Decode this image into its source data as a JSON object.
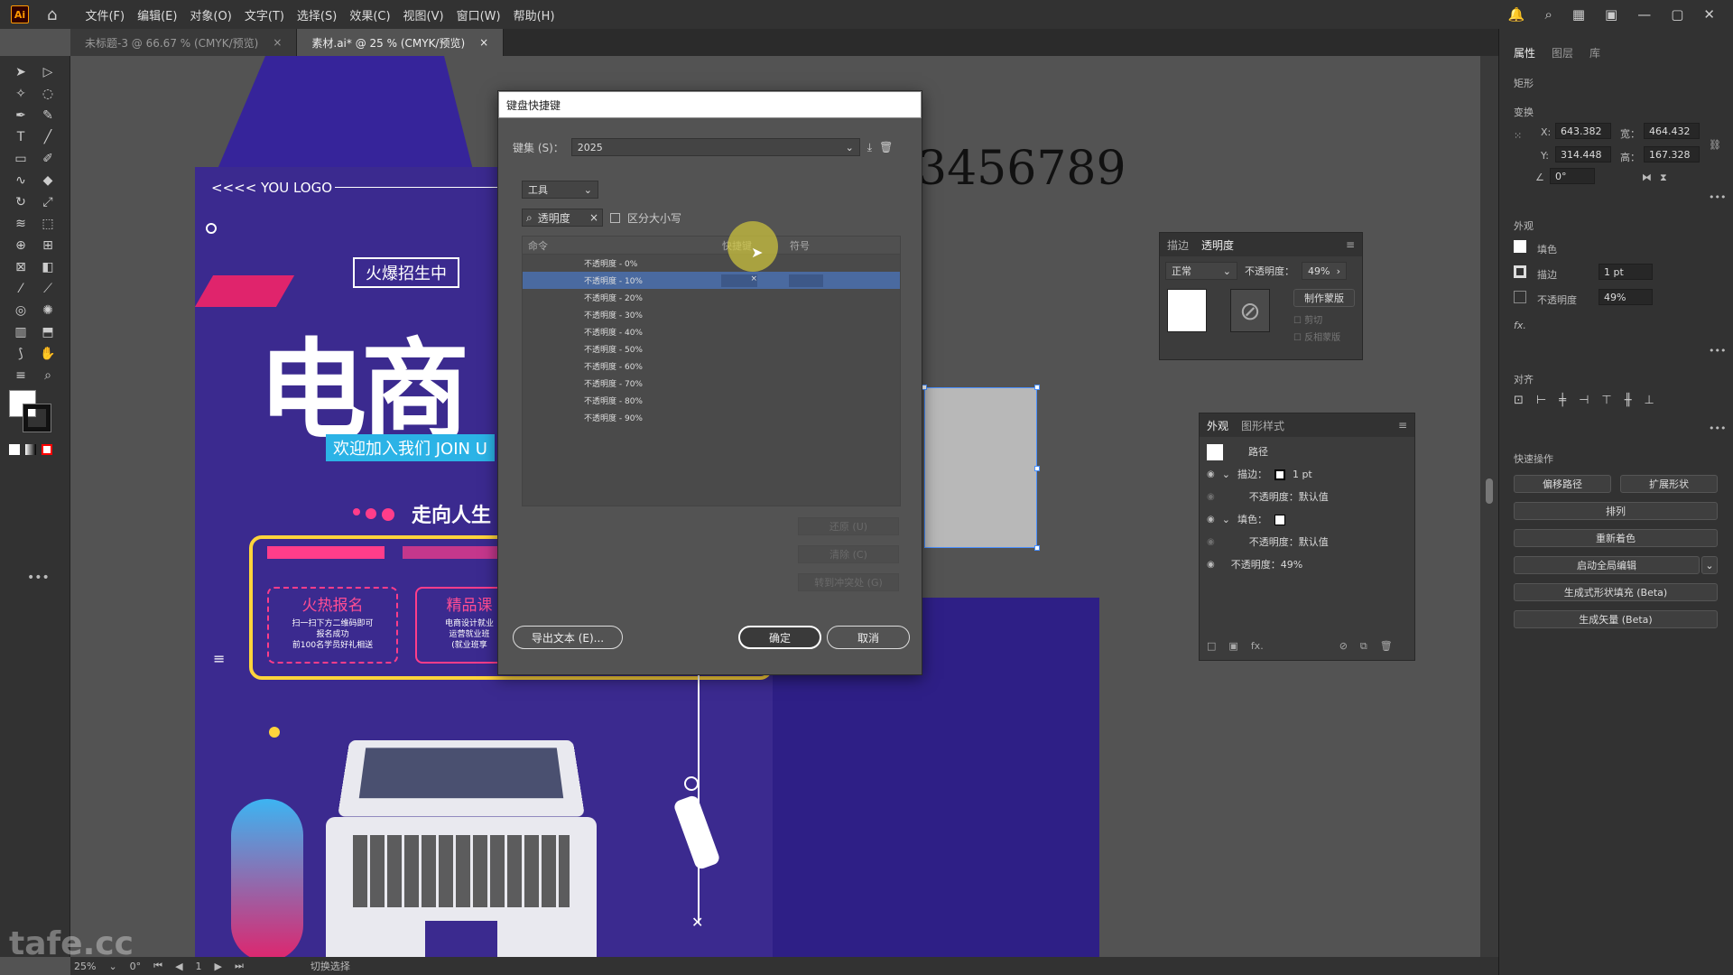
{
  "menubar": {
    "logo": "Ai",
    "items": [
      "文件(F)",
      "编辑(E)",
      "对象(O)",
      "文字(T)",
      "选择(S)",
      "效果(C)",
      "视图(V)",
      "窗口(W)",
      "帮助(H)"
    ]
  },
  "tabs": [
    {
      "label": "未标题-3 @ 66.67 % (CMYK/预览)",
      "active": false
    },
    {
      "label": "素材.ai* @ 25 % (CMYK/预览)",
      "active": true
    }
  ],
  "poster": {
    "logo": "<<<<  YOU LOGO",
    "hot": "火爆招生中",
    "big_title": "电商",
    "welcome": "欢迎加入我们 JOIN U",
    "goal": "走向人生",
    "reg_title": "火热报名",
    "reg_lines": [
      "扫一扫下方二维码即可",
      "报名成功",
      "前100名学员好礼相送"
    ],
    "course_title": "精品课",
    "course_lines": [
      "电商设计就业",
      "运营就业班",
      "(就业班享"
    ]
  },
  "canvas_number": "3456789",
  "dialog": {
    "title": "键盘快捷键",
    "keyset_label": "键集 (S)：",
    "keyset_value": "2025",
    "category": "工具",
    "search_value": "透明度",
    "case_label": "区分大小写",
    "columns": [
      "命令",
      "快捷键",
      "符号"
    ],
    "rows": [
      {
        "cmd": "不透明度 - 0%",
        "key": "",
        "sel": false
      },
      {
        "cmd": "不透明度 - 10%",
        "key": "×",
        "sel": true
      },
      {
        "cmd": "不透明度 - 20%",
        "key": "",
        "sel": false
      },
      {
        "cmd": "不透明度 - 30%",
        "key": "",
        "sel": false
      },
      {
        "cmd": "不透明度 - 40%",
        "key": "",
        "sel": false
      },
      {
        "cmd": "不透明度 - 50%",
        "key": "",
        "sel": false
      },
      {
        "cmd": "不透明度 - 60%",
        "key": "",
        "sel": false
      },
      {
        "cmd": "不透明度 - 70%",
        "key": "",
        "sel": false
      },
      {
        "cmd": "不透明度 - 80%",
        "key": "",
        "sel": false
      },
      {
        "cmd": "不透明度 - 90%",
        "key": "",
        "sel": false
      }
    ],
    "side_buttons": [
      "还原 (U)",
      "清除 (C)",
      "转到冲突处 (G)"
    ],
    "export": "导出文本 (E)...",
    "ok": "确定",
    "cancel": "取消"
  },
  "transparency_panel": {
    "tabs": [
      "描边",
      "透明度"
    ],
    "mode": "正常",
    "opacity_label": "不透明度：",
    "opacity_value": "49%",
    "make_mask": "制作蒙版",
    "clip": "剪切",
    "invert": "反相蒙版"
  },
  "appearance_panel": {
    "tabs": [
      "外观",
      "图形样式"
    ],
    "path": "路径",
    "stroke_label": "描边：",
    "stroke_value": "1 pt",
    "opacity_default": "不透明度：默认值",
    "fill_label": "填色：",
    "opacity_default2": "不透明度：默认值",
    "opacity": "不透明度：49%"
  },
  "right_panel": {
    "tabs": [
      "属性",
      "图层",
      "库"
    ],
    "object": "矩形",
    "transform": "变换",
    "x_label": "X:",
    "x": "643.382",
    "y_label": "Y:",
    "y": "314.448",
    "w_label": "宽：",
    "w": "464.432",
    "h_label": "高：",
    "h": "167.328",
    "angle": "0°",
    "appearance": "外观",
    "fill": "填色",
    "stroke": "描边",
    "stroke_value": "1 pt",
    "opacity": "不透明度",
    "opacity_value": "49%",
    "align": "对齐",
    "quick": "快速操作",
    "buttons": [
      "偏移路径",
      "扩展形状",
      "排列",
      "重新着色",
      "启动全局编辑",
      "生成式形状填充 (Beta)",
      "生成矢量 (Beta)"
    ]
  },
  "status": {
    "zoom": "25%",
    "angle": "0°",
    "page": "1",
    "mode": "切换选择"
  },
  "watermark": "tafe.cc"
}
